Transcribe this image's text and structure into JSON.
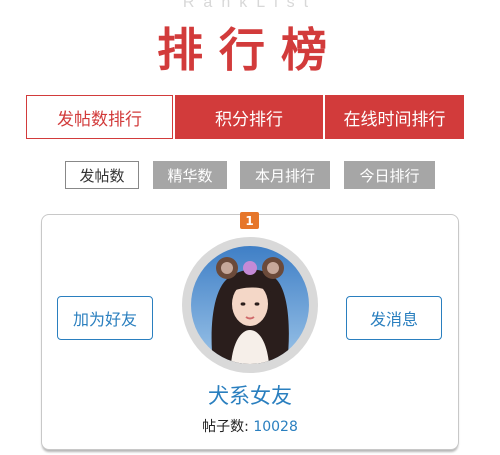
{
  "header": {
    "bg_text": "RankList",
    "title": "排行榜"
  },
  "tabs": [
    {
      "label": "发帖数排行",
      "active": true
    },
    {
      "label": "积分排行",
      "active": false
    },
    {
      "label": "在线时间排行",
      "active": false
    }
  ],
  "filters": [
    {
      "label": "发帖数",
      "active": true
    },
    {
      "label": "精华数",
      "active": false
    },
    {
      "label": "本月排行",
      "active": false
    },
    {
      "label": "今日排行",
      "active": false
    }
  ],
  "card": {
    "rank": "1",
    "add_friend_label": "加为好友",
    "send_message_label": "发消息",
    "username": "犬系女友",
    "post_count_label": "帖子数:",
    "post_count_value": "10028"
  },
  "colors": {
    "accent_red": "#d23b3b",
    "link_blue": "#2a7fbf",
    "inactive_gray": "#a6a6a6",
    "badge_orange": "#e6762a"
  },
  "icons": {
    "avatar": "user-avatar-photo"
  }
}
